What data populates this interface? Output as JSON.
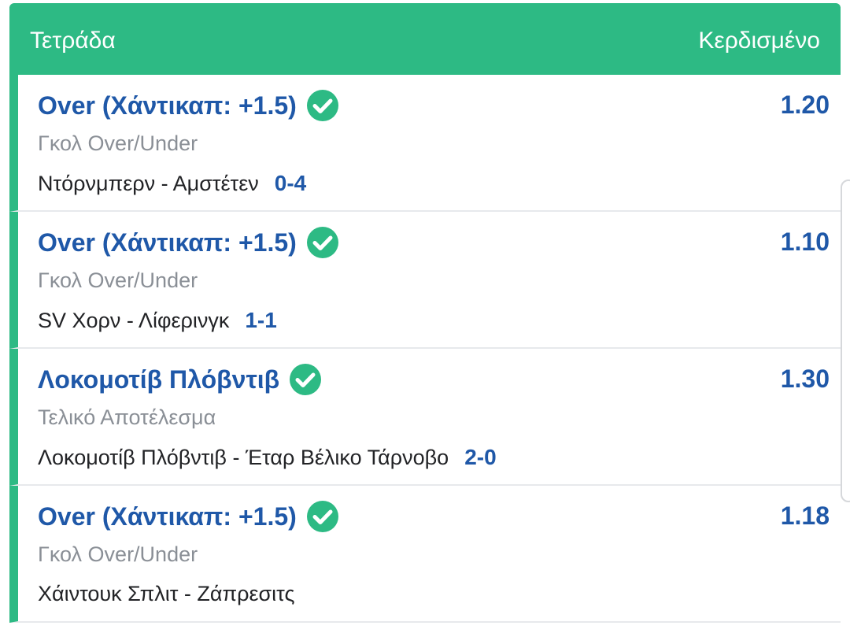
{
  "header": {
    "title": "Τετράδα",
    "status": "Κερδισμένο"
  },
  "colors": {
    "accent": "#2dba84",
    "blue": "#1f58a8",
    "muted": "#8a8f96"
  },
  "selections": [
    {
      "selection": "Over (Χάντικαπ: +1.5)",
      "odds": "1.20",
      "market": "Γκολ Over/Under",
      "event": "Ντόρνμπερν - Αμστέτεν",
      "score": "0-4",
      "icon": "check-circle-icon"
    },
    {
      "selection": "Over (Χάντικαπ: +1.5)",
      "odds": "1.10",
      "market": "Γκολ Over/Under",
      "event": "SV Χορν - Λίφερινγκ",
      "score": "1-1",
      "icon": "check-circle-icon"
    },
    {
      "selection": "Λοκομοτίβ Πλόβντιβ",
      "odds": "1.30",
      "market": "Τελικό Αποτέλεσμα",
      "event": "Λοκομοτίβ Πλόβντιβ - Έταρ Βέλικο Τάρνοβο",
      "score": "2-0",
      "icon": "check-circle-icon"
    },
    {
      "selection": "Over (Χάντικαπ: +1.5)",
      "odds": "1.18",
      "market": "Γκολ Over/Under",
      "event": "Χάιντουκ Σπλιτ - Ζάπρεσιτς",
      "score": "",
      "icon": "check-circle-icon"
    }
  ]
}
